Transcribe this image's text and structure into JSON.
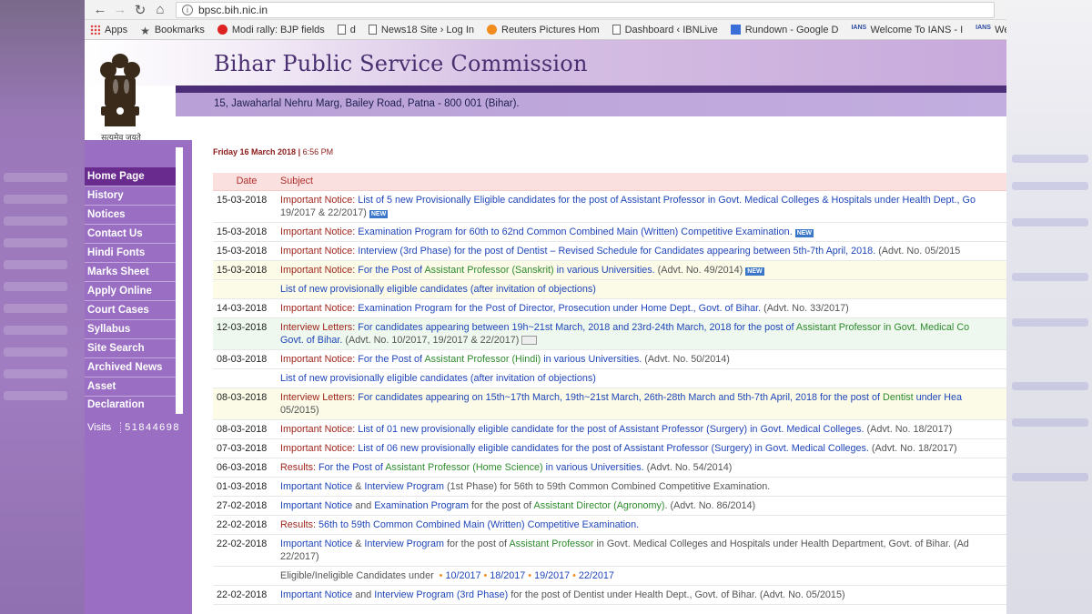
{
  "browser": {
    "url": "bpsc.bih.nic.in",
    "bookmarks": [
      {
        "label": "Apps",
        "icon": "apps-icon"
      },
      {
        "label": "Bookmarks",
        "icon": "star-icon"
      },
      {
        "label": "Modi rally: BJP fields",
        "icon": "red-circle-icon"
      },
      {
        "label": "d",
        "icon": "document-icon"
      },
      {
        "label": "News18 Site › Log In",
        "icon": "document-icon"
      },
      {
        "label": "Reuters Pictures Hom",
        "icon": "reuters-icon"
      },
      {
        "label": "Dashboard ‹ IBNLive",
        "icon": "document-icon"
      },
      {
        "label": "Rundown - Google D",
        "icon": "google-doc-icon"
      },
      {
        "label": "Welcome To IANS - I",
        "icon": "ians-icon"
      },
      {
        "label": "Welco",
        "icon": "ians-icon"
      }
    ]
  },
  "header": {
    "title": "Bihar Public Service Commission",
    "address": "15, Jawaharlal Nehru Marg, Bailey Road, Patna - 800 001 (Bihar).",
    "motto": "सत्यमेव जयते"
  },
  "menu": {
    "items": [
      "Home Page",
      "History",
      "Notices",
      "Contact Us",
      "Hindi Fonts",
      "Marks Sheet",
      "Apply Online",
      "Court Cases",
      "Syllabus",
      "Site Search",
      "Archived News",
      "Asset Declaration"
    ],
    "visits_label": "Visits",
    "visits_count": "51844698"
  },
  "content": {
    "date": "Friday 16 March 2018",
    "time": "6:56 PM",
    "columns": {
      "date": "Date",
      "subject": "Subject"
    },
    "new_tag": "NEW",
    "rows": [
      {
        "date": "15-03-2018",
        "parts": [
          [
            "imp",
            "Important Notice: "
          ],
          [
            "lnk",
            "List of 5 new Provisionally Eligible candidates for the post of Assistant Professor in Govt. Medical Colleges & Hospitals under Health Dept., Go"
          ]
        ],
        "line2": [
          [
            "gry",
            "19/2017 & 22/2017)"
          ]
        ],
        "tag2": "new",
        "style": ""
      },
      {
        "date": "15-03-2018",
        "parts": [
          [
            "imp",
            "Important Notice: "
          ],
          [
            "lnk",
            "Examination Program for 60th to 62nd Common Combined Main (Written) Competitive Examination."
          ]
        ],
        "tag": "new",
        "style": ""
      },
      {
        "date": "15-03-2018",
        "parts": [
          [
            "imp",
            "Important Notice: "
          ],
          [
            "lnk",
            "Interview (3rd Phase) for the post of Dentist – Revised Schedule for Candidates appearing between 5th-7th April, 2018."
          ],
          [
            "gry",
            "  (Advt. No. 05/2015"
          ]
        ],
        "style": ""
      },
      {
        "date": "15-03-2018",
        "parts": [
          [
            "imp",
            "Important Notice: "
          ],
          [
            "lnk",
            "For the Post of "
          ],
          [
            "grn",
            "Assistant Professor (Sanskrit)"
          ],
          [
            "lnk",
            " in various Universities."
          ],
          [
            "gry",
            " (Advt. No. 49/2014)"
          ]
        ],
        "tag": "new",
        "style": "alt"
      },
      {
        "date": "",
        "parts": [
          [
            "lnk",
            "List of new provisionally eligible candidates (after invitation of objections)"
          ]
        ],
        "style": "alt"
      },
      {
        "date": "14-03-2018",
        "parts": [
          [
            "imp",
            "Important Notice: "
          ],
          [
            "lnk",
            "Examination Program for the Post of Director, Prosecution under Home Dept., Govt. of Bihar."
          ],
          [
            "gry",
            " (Advt. No. 33/2017)"
          ]
        ],
        "style": ""
      },
      {
        "date": "12-03-2018",
        "parts": [
          [
            "imp",
            "Interview Letters: "
          ],
          [
            "lnk",
            "For candidates appearing between 19h~21st March, 2018 and 23rd-24th March, 2018 for the post of "
          ],
          [
            "grn",
            "Assistant Professor in Govt. Medical Co"
          ]
        ],
        "line2": [
          [
            "lnk",
            "Govt. of Bihar."
          ],
          [
            "gry",
            " (Advt. No. 10/2017, 19/2017 & 22/2017)"
          ]
        ],
        "tag2": "img",
        "style": "green"
      },
      {
        "date": "08-03-2018",
        "parts": [
          [
            "imp",
            "Important Notice: "
          ],
          [
            "lnk",
            "For the Post of "
          ],
          [
            "grn",
            "Assistant Professor (Hindi)"
          ],
          [
            "lnk",
            " in various Universities."
          ],
          [
            "gry",
            " (Advt. No. 50/2014)"
          ]
        ],
        "style": ""
      },
      {
        "date": "",
        "parts": [
          [
            "lnk",
            "List of new provisionally eligible candidates (after invitation of objections)"
          ]
        ],
        "style": ""
      },
      {
        "date": "08-03-2018",
        "parts": [
          [
            "imp",
            "Interview Letters: "
          ],
          [
            "lnk",
            "For candidates appearing on 15th~17th March, 19th~21st March, 26th-28th March and 5th-7th April, 2018 for the post of "
          ],
          [
            "grn",
            "Dentist"
          ],
          [
            "lnk",
            " under Hea"
          ]
        ],
        "line2": [
          [
            "gry",
            "05/2015)"
          ]
        ],
        "style": "alt"
      },
      {
        "date": "08-03-2018",
        "parts": [
          [
            "imp",
            "Important Notice: "
          ],
          [
            "lnk",
            "List of 01 new provisionally eligible candidate for the post of Assistant Professor (Surgery) in Govt. Medical Colleges."
          ],
          [
            "gry",
            " (Advt. No. 18/2017)"
          ]
        ],
        "style": ""
      },
      {
        "date": "07-03-2018",
        "parts": [
          [
            "imp",
            "Important Notice: "
          ],
          [
            "lnk",
            "List of 06 new provisionally eligible candidates for the post of Assistant Professor (Surgery) in Govt. Medical Colleges."
          ],
          [
            "gry",
            " (Advt. No. 18/2017)"
          ]
        ],
        "style": ""
      },
      {
        "date": "06-03-2018",
        "parts": [
          [
            "imp",
            "Results: "
          ],
          [
            "lnk",
            "For the Post of "
          ],
          [
            "grn",
            "Assistant Professor (Home Science)"
          ],
          [
            "lnk",
            " in various Universities."
          ],
          [
            "gry",
            " (Advt. No. 54/2014)"
          ]
        ],
        "style": ""
      },
      {
        "date": "01-03-2018",
        "parts": [
          [
            "lnk",
            "Important Notice"
          ],
          [
            "gry",
            " & "
          ],
          [
            "lnk",
            "Interview Program"
          ],
          [
            "gry",
            " (1st Phase) for 56th to 59th Common Combined Competitive Examination."
          ]
        ],
        "style": ""
      },
      {
        "date": "27-02-2018",
        "parts": [
          [
            "lnk",
            "Important Notice"
          ],
          [
            "gry",
            " and "
          ],
          [
            "lnk",
            "Examination Program"
          ],
          [
            "gry",
            " for the post of "
          ],
          [
            "grn",
            "Assistant Director (Agronomy)"
          ],
          [
            "gry",
            ". (Advt. No. 86/2014)"
          ]
        ],
        "style": ""
      },
      {
        "date": "22-02-2018",
        "parts": [
          [
            "imp",
            "Results: "
          ],
          [
            "lnk",
            "56th to 59th Common Combined Main (Written) Competitive Examination."
          ]
        ],
        "style": ""
      },
      {
        "date": "22-02-2018",
        "parts": [
          [
            "lnk",
            "Important Notice"
          ],
          [
            "gry",
            " & "
          ],
          [
            "lnk",
            "Interview Program"
          ],
          [
            "gry",
            " for the post of "
          ],
          [
            "grn",
            "Assistant Professor"
          ],
          [
            "gry",
            " in Govt. Medical Colleges and Hospitals under Health Department, Govt. of Bihar. (Ad"
          ]
        ],
        "line2": [
          [
            "gry",
            "22/2017)"
          ]
        ],
        "style": ""
      },
      {
        "date": "",
        "parts": [
          [
            "gry",
            "Eligible/Ineligible Candidates under "
          ],
          [
            "dot",
            "•"
          ],
          [
            "lnk",
            "10/2017"
          ],
          [
            "dot",
            "•"
          ],
          [
            "lnk",
            "18/2017"
          ],
          [
            "dot",
            "•"
          ],
          [
            "lnk",
            "19/2017"
          ],
          [
            "dot",
            "•"
          ],
          [
            "lnk",
            "22/2017"
          ]
        ],
        "style": ""
      },
      {
        "date": "22-02-2018",
        "parts": [
          [
            "lnk",
            "Important Notice"
          ],
          [
            "gry",
            " and "
          ],
          [
            "lnk",
            "Interview Program (3rd Phase)"
          ],
          [
            "gry",
            " for the post of Dentist under Health Dept., Govt. of Bihar. (Advt. No. 05/2015)"
          ]
        ],
        "style": ""
      }
    ]
  }
}
